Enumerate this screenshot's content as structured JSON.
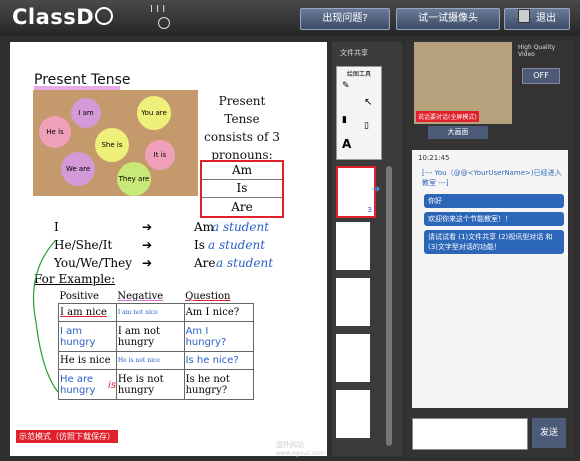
{
  "app": {
    "logo_text": "ClassD",
    "logo_tail": "o",
    "ticks": "I   I   I"
  },
  "toolbar": {
    "help": "出现问题?",
    "camera": "试一试摄像头",
    "exit": "退出"
  },
  "board": {
    "title": "Present Tense",
    "stickies": [
      "I am",
      "You are",
      "He is",
      "She is",
      "It is",
      "We are",
      "They are"
    ],
    "rule_lines": [
      "Present",
      "Tense",
      "consists of 3",
      "pronouns:"
    ],
    "verbs": [
      "Am",
      "Is",
      "Are"
    ],
    "pronoun_rows": [
      {
        "pronoun": "I",
        "verb": "Am",
        "hand": "a student"
      },
      {
        "pronoun": "He/She/It",
        "verb": "Is",
        "hand": "a student"
      },
      {
        "pronoun": "You/We/They",
        "verb": "Are",
        "hand": "a student"
      }
    ],
    "example_label": "For Example:",
    "columns": [
      "Positive",
      "Negative",
      "Question"
    ],
    "rows": [
      {
        "pos": "I am nice",
        "neg": "I am not nice",
        "q": "Am I nice?"
      },
      {
        "pos": "I am hungry",
        "neg": "I am not hungry",
        "q": "Am I hungry?"
      },
      {
        "pos": "He is nice",
        "neg": "He is not nice",
        "q": "Is he nice?"
      },
      {
        "pos": "He are hungry",
        "neg": "He is not hungry",
        "q": "Is he not hungry?"
      }
    ],
    "hand_is": "is",
    "mode_label": "示范模式（仿照下载保存）"
  },
  "files": {
    "title": "文件共享",
    "tools_title": "绘图工具",
    "page_badge": "3"
  },
  "video": {
    "hq_label": "High Quality Video",
    "hq_button": "OFF",
    "caption": "说话要对话(全屏模式)",
    "fullscreen": "大画面"
  },
  "chat": {
    "time": "10:21:45",
    "system": "[--- You（@@<YourUserName>)已经进入教室 ---]",
    "messages": [
      "你好",
      "欢迎你来这个节能教室！！",
      "请试试看 (1)文件共享 (2)视讯型对话 和 (3)文字型对话的功能！"
    ],
    "send": "发送"
  },
  "watermark": {
    "text": "国外网站",
    "url": "www.egouz.com"
  },
  "colors": {
    "accent_blue": "#2c66b8",
    "highlight_red": "#e0202a",
    "cork": "#c49a6c"
  }
}
